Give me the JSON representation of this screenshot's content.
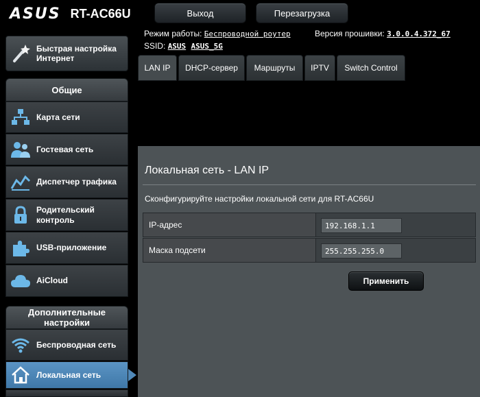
{
  "header": {
    "brand": "ASUS",
    "model": "RT-AC66U",
    "logout_label": "Выход",
    "reboot_label": "Перезагрузка"
  },
  "info": {
    "mode_label": "Режим работы:",
    "mode_value": "Беспроводной роутер",
    "firmware_label": "Версия прошивки:",
    "firmware_value": "3.0.0.4.372_67",
    "ssid_label": "SSID:",
    "ssid_1": "ASUS",
    "ssid_2": "ASUS_5G"
  },
  "sidebar": {
    "quick_setup": "Быстрая настройка Интернет",
    "general_header": "Общие",
    "general_items": [
      {
        "label": "Карта сети",
        "icon": "network-map-icon"
      },
      {
        "label": "Гостевая сеть",
        "icon": "guest-network-icon"
      },
      {
        "label": "Диспетчер трафика",
        "icon": "traffic-manager-icon"
      },
      {
        "label": "Родительский контроль",
        "icon": "parental-control-icon"
      },
      {
        "label": "USB-приложение",
        "icon": "usb-application-icon"
      },
      {
        "label": "AiCloud",
        "icon": "cloud-icon"
      }
    ],
    "advanced_header": "Дополнительные настройки",
    "advanced_items": [
      {
        "label": "Беспроводная сеть",
        "icon": "wireless-icon"
      },
      {
        "label": "Локальная сеть",
        "icon": "home-icon",
        "active": true
      }
    ]
  },
  "tabs": [
    {
      "label": "LAN IP",
      "active": true
    },
    {
      "label": "DHCP-сервер"
    },
    {
      "label": "Маршруты"
    },
    {
      "label": "IPTV"
    },
    {
      "label": "Switch Control"
    }
  ],
  "main": {
    "title": "Локальная сеть - LAN IP",
    "description": "Сконфигурируйте настройки локальной сети для RT-AC66U",
    "fields": [
      {
        "label": "IP-адрес",
        "value": "192.168.1.1"
      },
      {
        "label": "Маска подсети",
        "value": "255.255.255.0"
      }
    ],
    "apply_label": "Применить"
  },
  "colors": {
    "accent": "#4f88b8",
    "panel": "#4d5356",
    "background": "#000000"
  }
}
